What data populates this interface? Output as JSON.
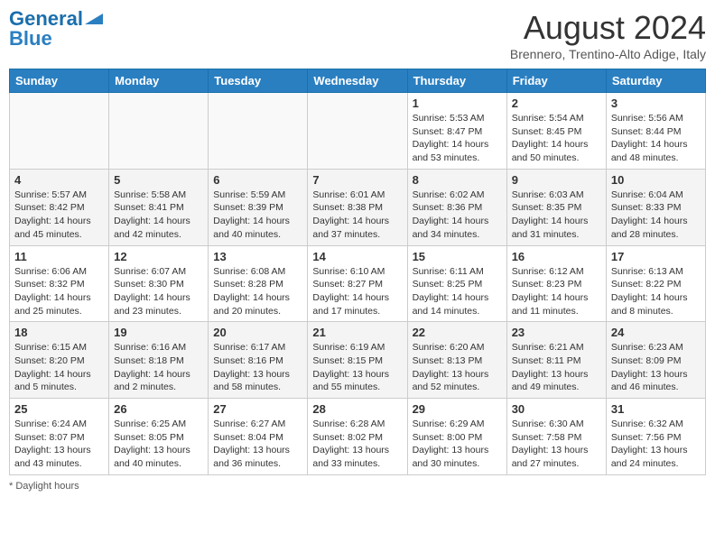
{
  "header": {
    "logo_line1": "General",
    "logo_line2": "Blue",
    "month_title": "August 2024",
    "location": "Brennero, Trentino-Alto Adige, Italy"
  },
  "days_of_week": [
    "Sunday",
    "Monday",
    "Tuesday",
    "Wednesday",
    "Thursday",
    "Friday",
    "Saturday"
  ],
  "weeks": [
    [
      {
        "day": "",
        "info": ""
      },
      {
        "day": "",
        "info": ""
      },
      {
        "day": "",
        "info": ""
      },
      {
        "day": "",
        "info": ""
      },
      {
        "day": "1",
        "info": "Sunrise: 5:53 AM\nSunset: 8:47 PM\nDaylight: 14 hours\nand 53 minutes."
      },
      {
        "day": "2",
        "info": "Sunrise: 5:54 AM\nSunset: 8:45 PM\nDaylight: 14 hours\nand 50 minutes."
      },
      {
        "day": "3",
        "info": "Sunrise: 5:56 AM\nSunset: 8:44 PM\nDaylight: 14 hours\nand 48 minutes."
      }
    ],
    [
      {
        "day": "4",
        "info": "Sunrise: 5:57 AM\nSunset: 8:42 PM\nDaylight: 14 hours\nand 45 minutes."
      },
      {
        "day": "5",
        "info": "Sunrise: 5:58 AM\nSunset: 8:41 PM\nDaylight: 14 hours\nand 42 minutes."
      },
      {
        "day": "6",
        "info": "Sunrise: 5:59 AM\nSunset: 8:39 PM\nDaylight: 14 hours\nand 40 minutes."
      },
      {
        "day": "7",
        "info": "Sunrise: 6:01 AM\nSunset: 8:38 PM\nDaylight: 14 hours\nand 37 minutes."
      },
      {
        "day": "8",
        "info": "Sunrise: 6:02 AM\nSunset: 8:36 PM\nDaylight: 14 hours\nand 34 minutes."
      },
      {
        "day": "9",
        "info": "Sunrise: 6:03 AM\nSunset: 8:35 PM\nDaylight: 14 hours\nand 31 minutes."
      },
      {
        "day": "10",
        "info": "Sunrise: 6:04 AM\nSunset: 8:33 PM\nDaylight: 14 hours\nand 28 minutes."
      }
    ],
    [
      {
        "day": "11",
        "info": "Sunrise: 6:06 AM\nSunset: 8:32 PM\nDaylight: 14 hours\nand 25 minutes."
      },
      {
        "day": "12",
        "info": "Sunrise: 6:07 AM\nSunset: 8:30 PM\nDaylight: 14 hours\nand 23 minutes."
      },
      {
        "day": "13",
        "info": "Sunrise: 6:08 AM\nSunset: 8:28 PM\nDaylight: 14 hours\nand 20 minutes."
      },
      {
        "day": "14",
        "info": "Sunrise: 6:10 AM\nSunset: 8:27 PM\nDaylight: 14 hours\nand 17 minutes."
      },
      {
        "day": "15",
        "info": "Sunrise: 6:11 AM\nSunset: 8:25 PM\nDaylight: 14 hours\nand 14 minutes."
      },
      {
        "day": "16",
        "info": "Sunrise: 6:12 AM\nSunset: 8:23 PM\nDaylight: 14 hours\nand 11 minutes."
      },
      {
        "day": "17",
        "info": "Sunrise: 6:13 AM\nSunset: 8:22 PM\nDaylight: 14 hours\nand 8 minutes."
      }
    ],
    [
      {
        "day": "18",
        "info": "Sunrise: 6:15 AM\nSunset: 8:20 PM\nDaylight: 14 hours\nand 5 minutes."
      },
      {
        "day": "19",
        "info": "Sunrise: 6:16 AM\nSunset: 8:18 PM\nDaylight: 14 hours\nand 2 minutes."
      },
      {
        "day": "20",
        "info": "Sunrise: 6:17 AM\nSunset: 8:16 PM\nDaylight: 13 hours\nand 58 minutes."
      },
      {
        "day": "21",
        "info": "Sunrise: 6:19 AM\nSunset: 8:15 PM\nDaylight: 13 hours\nand 55 minutes."
      },
      {
        "day": "22",
        "info": "Sunrise: 6:20 AM\nSunset: 8:13 PM\nDaylight: 13 hours\nand 52 minutes."
      },
      {
        "day": "23",
        "info": "Sunrise: 6:21 AM\nSunset: 8:11 PM\nDaylight: 13 hours\nand 49 minutes."
      },
      {
        "day": "24",
        "info": "Sunrise: 6:23 AM\nSunset: 8:09 PM\nDaylight: 13 hours\nand 46 minutes."
      }
    ],
    [
      {
        "day": "25",
        "info": "Sunrise: 6:24 AM\nSunset: 8:07 PM\nDaylight: 13 hours\nand 43 minutes."
      },
      {
        "day": "26",
        "info": "Sunrise: 6:25 AM\nSunset: 8:05 PM\nDaylight: 13 hours\nand 40 minutes."
      },
      {
        "day": "27",
        "info": "Sunrise: 6:27 AM\nSunset: 8:04 PM\nDaylight: 13 hours\nand 36 minutes."
      },
      {
        "day": "28",
        "info": "Sunrise: 6:28 AM\nSunset: 8:02 PM\nDaylight: 13 hours\nand 33 minutes."
      },
      {
        "day": "29",
        "info": "Sunrise: 6:29 AM\nSunset: 8:00 PM\nDaylight: 13 hours\nand 30 minutes."
      },
      {
        "day": "30",
        "info": "Sunrise: 6:30 AM\nSunset: 7:58 PM\nDaylight: 13 hours\nand 27 minutes."
      },
      {
        "day": "31",
        "info": "Sunrise: 6:32 AM\nSunset: 7:56 PM\nDaylight: 13 hours\nand 24 minutes."
      }
    ]
  ],
  "footer": {
    "note": "Daylight hours"
  }
}
